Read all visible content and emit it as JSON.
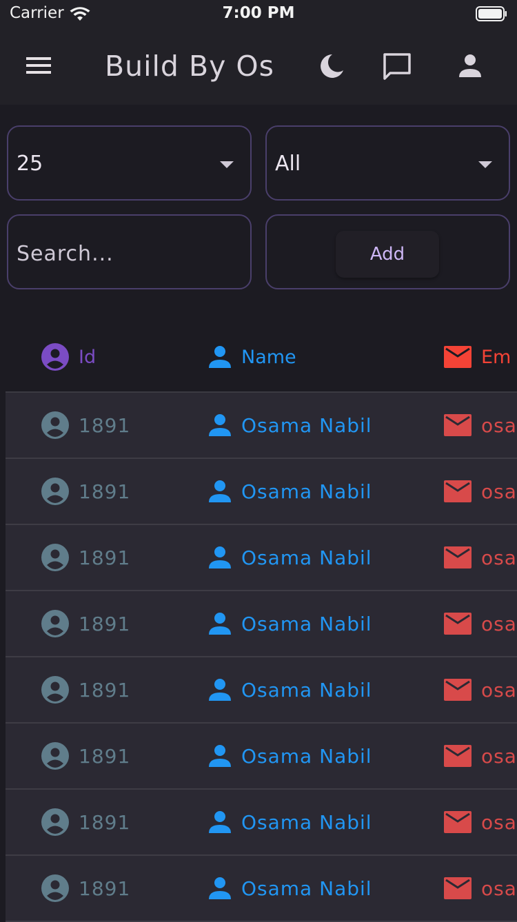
{
  "status_bar": {
    "carrier": "Carrier",
    "time": "7:00 PM"
  },
  "app_bar": {
    "title": "Build By Os",
    "icons": [
      "menu-icon",
      "moon-icon",
      "chat-icon",
      "person-icon"
    ]
  },
  "filters": {
    "page_size": "25",
    "category": "All",
    "search_placeholder": "Search...",
    "add_label": "Add"
  },
  "table": {
    "columns": [
      {
        "label": "Id",
        "icon": "account-circle-icon",
        "color": "#7b4cc4"
      },
      {
        "label": "Name",
        "icon": "person-icon",
        "color": "#2196f3"
      },
      {
        "label": "Em",
        "icon": "mail-icon",
        "color": "#f44336"
      }
    ],
    "rows": [
      {
        "id": "1891",
        "name": "Osama Nabil",
        "email": "osa"
      },
      {
        "id": "1891",
        "name": "Osama Nabil",
        "email": "osa"
      },
      {
        "id": "1891",
        "name": "Osama Nabil",
        "email": "osa"
      },
      {
        "id": "1891",
        "name": "Osama Nabil",
        "email": "osa"
      },
      {
        "id": "1891",
        "name": "Osama Nabil",
        "email": "osa"
      },
      {
        "id": "1891",
        "name": "Osama Nabil",
        "email": "osa"
      },
      {
        "id": "1891",
        "name": "Osama Nabil",
        "email": "osa"
      },
      {
        "id": "1891",
        "name": "Osama Nabil",
        "email": "osa"
      }
    ]
  },
  "colors": {
    "id_muted": "#607d8b",
    "name_blue": "#2196f3",
    "email_red": "#d84a4a",
    "accent": "#cdb6f5"
  }
}
